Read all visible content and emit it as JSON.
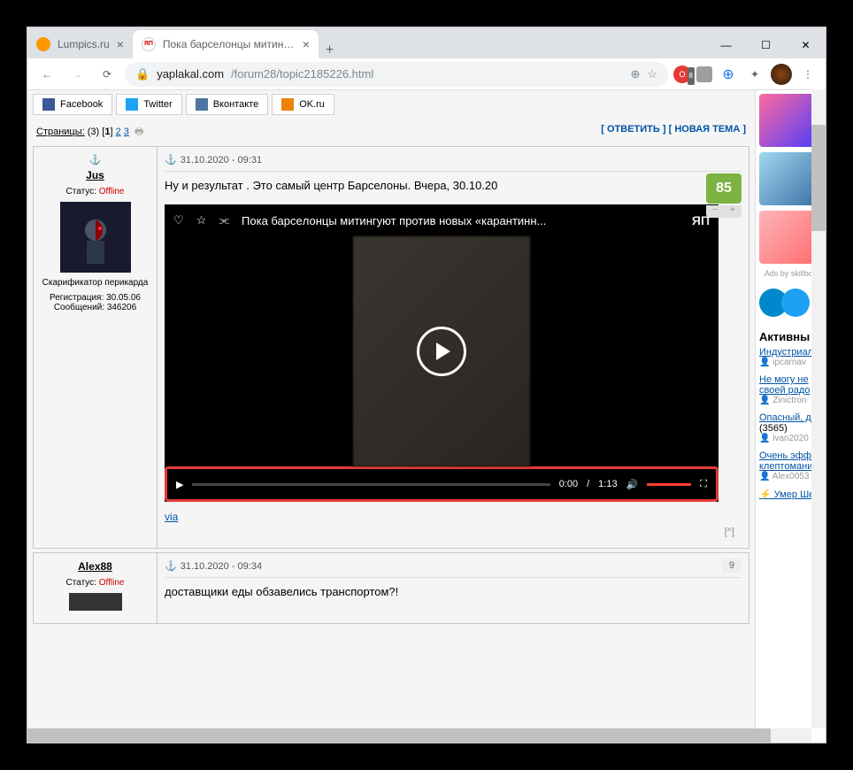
{
  "window": {
    "minimize": "—",
    "maximize": "☐",
    "close": "✕"
  },
  "tabs": [
    {
      "title": "Lumpics.ru",
      "icon_color": "#ff9800"
    },
    {
      "title": "Пока барсeлонцы митингуют п",
      "icon_text": "ЯП"
    }
  ],
  "url": {
    "domain": "yaplakal.com",
    "path": "/forum28/topic2185226.html"
  },
  "ext_badge": "8",
  "share": [
    {
      "label": "Facebook",
      "color": "#3b5998"
    },
    {
      "label": "Twitter",
      "color": "#1da1f2"
    },
    {
      "label": "Вконтакте",
      "color": "#4c75a3"
    },
    {
      "label": "OK.ru",
      "color": "#ee8208"
    }
  ],
  "pager": {
    "label": "Страницы:",
    "total": "(3)",
    "current": "1",
    "pages": [
      "2",
      "3"
    ]
  },
  "actions": {
    "reply": "[ ОТВЕТИТЬ ]",
    "newtopic": "[ НОВАЯ ТЕМА ]"
  },
  "posts": [
    {
      "user": "Jus",
      "status_label": "Статус:",
      "status": "Offline",
      "role": "Скарификатор перикарда",
      "reg": "Регистрация: 30.05.06",
      "msgs": "Сообщений: 346206",
      "date": "31.10.2020 - 09:31",
      "text": "Ну и результат . Это самый центр Барселоны. Вчера, 30.10.20",
      "rating": "85",
      "via": "via",
      "video": {
        "title": "Пока барсeлонцы митингуют против новых «карантинн...",
        "logo": "ЯП",
        "time_current": "0:00",
        "time_sep": "/",
        "time_total": "1:13"
      }
    },
    {
      "user": "Alex88",
      "status_label": "Статус:",
      "status": "Offline",
      "date": "31.10.2020 - 09:34",
      "text": "доставщики еды обзавелись транспортом?!",
      "rating": "9"
    }
  ],
  "foot_icon": "[^]",
  "sidebar": {
    "ads_label": "Ads by skillbox",
    "title": "Активны",
    "topics": [
      {
        "title": "Индустриал",
        "author": "ipcarnav"
      },
      {
        "title": "Не могу не",
        "sub": "своей радо",
        "author": "Zinictron"
      },
      {
        "title": "Опасный, д",
        "count": "(3565)",
        "author": "ivan2020"
      },
      {
        "title": "Очень эфф",
        "sub": "клептомани",
        "author": "Alex0053"
      },
      {
        "title": "⚡ Умер Ше"
      }
    ]
  }
}
